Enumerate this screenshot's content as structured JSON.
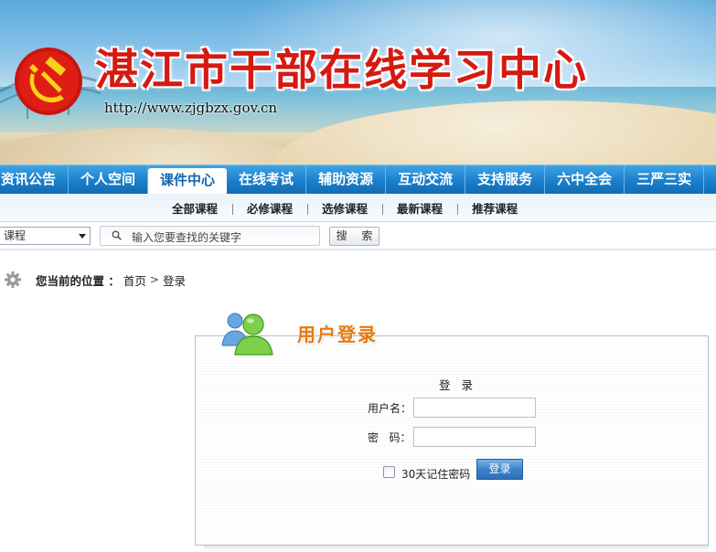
{
  "banner": {
    "title": "湛江市干部在线学习中心",
    "url": "http://www.zjgbzx.gov.cn"
  },
  "main_nav": {
    "items": [
      {
        "label": "资讯公告",
        "active": false
      },
      {
        "label": "个人空间",
        "active": false
      },
      {
        "label": "课件中心",
        "active": true
      },
      {
        "label": "在线考试",
        "active": false
      },
      {
        "label": "辅助资源",
        "active": false
      },
      {
        "label": "互动交流",
        "active": false
      },
      {
        "label": "支持服务",
        "active": false
      },
      {
        "label": "六中全会",
        "active": false
      },
      {
        "label": "三严三实",
        "active": false
      }
    ]
  },
  "sub_nav": {
    "items": [
      "全部课程",
      "必修课程",
      "选修课程",
      "最新课程",
      "推荐课程"
    ]
  },
  "search": {
    "scope_value": "课程",
    "placeholder": "输入您要查找的关键字",
    "button_label": "搜 索"
  },
  "breadcrumb": {
    "label": "您当前的位置 ：",
    "home": "首页",
    "separator": ">",
    "current": "登录"
  },
  "login": {
    "panel_title": "用户登录",
    "form_title": "登 录",
    "username_label": "用户名：",
    "password_label": "密   码：",
    "username_value": "",
    "password_value": "",
    "remember_label": "30天记住密码",
    "remember_checked": false,
    "submit_label": "登录"
  },
  "colors": {
    "title_red": "#d41a12",
    "nav_blue": "#1a7fcb",
    "panel_orange": "#e8790e",
    "button_blue": "#3c82c9"
  },
  "icons": [
    "party-emblem-icon",
    "gear-icon",
    "search-icon",
    "users-icon",
    "chevron-down-icon",
    "checkbox-icon"
  ]
}
